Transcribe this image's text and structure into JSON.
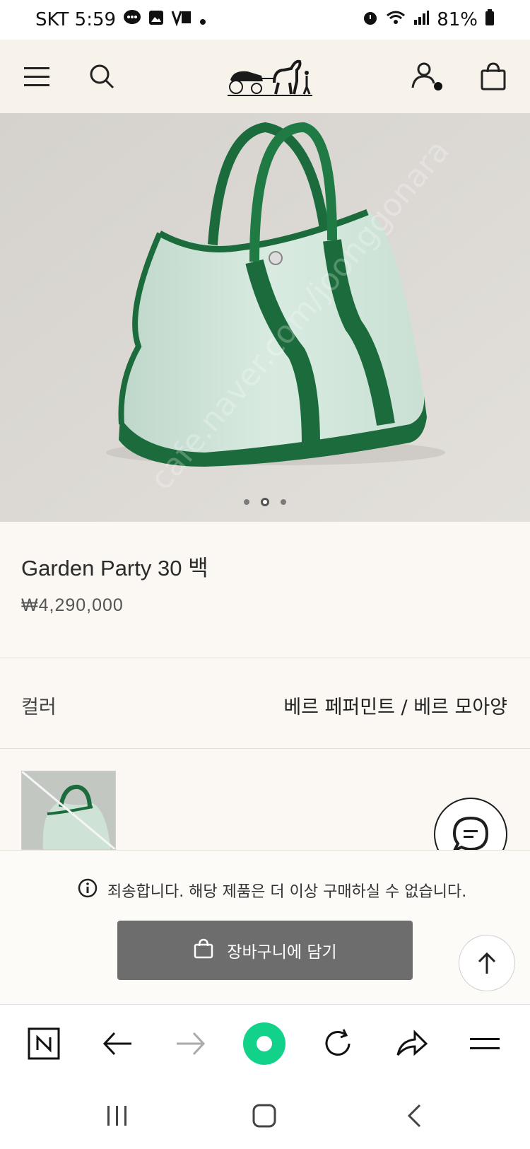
{
  "status_bar": {
    "carrier_time": "SKT 5:59",
    "battery": "81%",
    "icons": [
      "chat-bubble-icon",
      "gallery-icon",
      "volte-icon",
      "dot-icon",
      "alarm-icon",
      "wifi-icon",
      "signal-icon",
      "battery-icon"
    ]
  },
  "header": {
    "icons": [
      "menu-icon",
      "search-icon",
      "brand-logo-carriage",
      "account-icon",
      "shopping-bag-icon"
    ]
  },
  "hero": {
    "carousel_count": 3,
    "active_index": 1,
    "watermark": "cafe.naver.com/joonggonara"
  },
  "product": {
    "title": "Garden Party 30 백",
    "price": "₩4,290,000"
  },
  "color": {
    "label": "컬러",
    "value": "베르 페퍼민트 / 베르 모아양"
  },
  "notice": {
    "text": "죄송합니다. 해당 제품은 더 이상 구매하실 수 없습니다."
  },
  "cart_button": {
    "label": "장바구니에 담기"
  },
  "browser_bar": {
    "icons": [
      "naver-n-icon",
      "back-arrow-icon",
      "forward-arrow-icon",
      "green-home-icon",
      "refresh-icon",
      "share-icon",
      "menu-lines-icon"
    ]
  },
  "system_nav": {
    "icons": [
      "recent-apps-icon",
      "home-icon",
      "back-icon"
    ]
  },
  "colors": {
    "accent_green": "#1c6b3c",
    "canvas_mint": "#cfe5d9",
    "background": "#fbf8f3"
  }
}
